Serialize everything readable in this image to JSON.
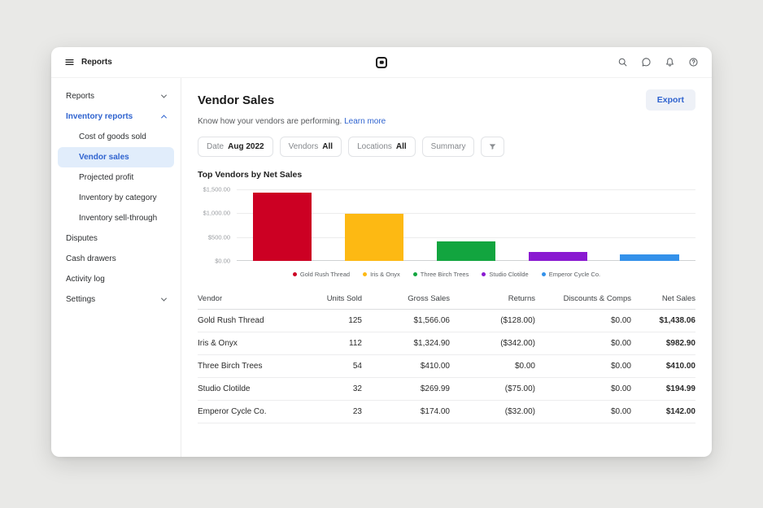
{
  "topbar": {
    "menu_label": "Reports"
  },
  "sidebar": {
    "items": [
      {
        "label": "Reports"
      },
      {
        "label": "Inventory reports"
      },
      {
        "label": "Cost of goods sold"
      },
      {
        "label": "Vendor sales"
      },
      {
        "label": "Projected profit"
      },
      {
        "label": "Inventory by category"
      },
      {
        "label": "Inventory sell-through"
      },
      {
        "label": "Disputes"
      },
      {
        "label": "Cash drawers"
      },
      {
        "label": "Activity log"
      },
      {
        "label": "Settings"
      }
    ]
  },
  "main": {
    "title": "Vendor Sales",
    "export_label": "Export",
    "subtitle": "Know how your vendors are performing.",
    "learn_more": "Learn more",
    "filters": [
      {
        "label": "Date",
        "value": "Aug 2022"
      },
      {
        "label": "Vendors",
        "value": "All"
      },
      {
        "label": "Locations",
        "value": "All"
      },
      {
        "label": "Summary",
        "value": ""
      }
    ]
  },
  "chart_data": {
    "type": "bar",
    "title": "Top Vendors by Net Sales",
    "categories": [
      "Gold Rush Thread",
      "Iris & Onyx",
      "Three Birch Trees",
      "Studio Clotilde",
      "Emperor Cycle Co."
    ],
    "values": [
      1438.06,
      982.9,
      410.0,
      194.99,
      142.0
    ],
    "colors": [
      "#cc0023",
      "#fdb913",
      "#12a53f",
      "#8a1ad1",
      "#3391ea"
    ],
    "ylim": [
      0,
      1500
    ],
    "y_ticks": [
      "$1,500.00",
      "$1,000.00",
      "$500.00",
      "$0.00"
    ],
    "xlabel": "",
    "ylabel": "",
    "grid": true,
    "legend_position": "bottom"
  },
  "table": {
    "headers": [
      "Vendor",
      "Units Sold",
      "Gross Sales",
      "Returns",
      "Discounts & Comps",
      "Net Sales"
    ],
    "rows": [
      [
        "Gold Rush Thread",
        "125",
        "$1,566.06",
        "($128.00)",
        "$0.00",
        "$1,438.06"
      ],
      [
        "Iris & Onyx",
        "112",
        "$1,324.90",
        "($342.00)",
        "$0.00",
        "$982.90"
      ],
      [
        "Three Birch Trees",
        "54",
        "$410.00",
        "$0.00",
        "$0.00",
        "$410.00"
      ],
      [
        "Studio Clotilde",
        "32",
        "$269.99",
        "($75.00)",
        "$0.00",
        "$194.99"
      ],
      [
        "Emperor Cycle Co.",
        "23",
        "$174.00",
        "($32.00)",
        "$0.00",
        "$142.00"
      ]
    ]
  },
  "colors": {
    "accent": "#2f63cf",
    "selected_bg": "#e1edfb",
    "page_bg": "#e9e9e7"
  }
}
